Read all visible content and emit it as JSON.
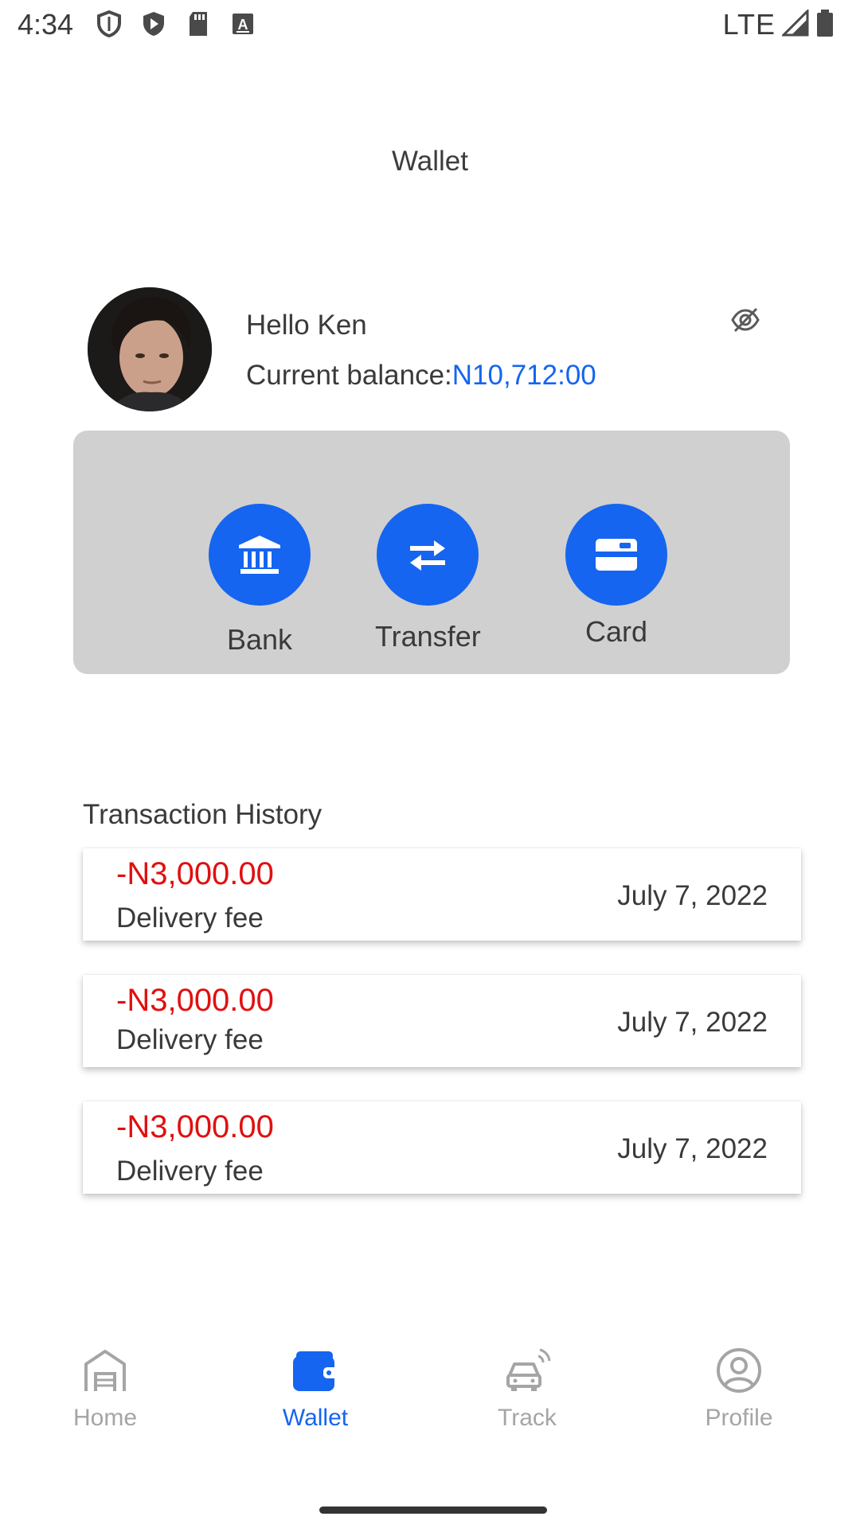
{
  "status_bar": {
    "time": "4:34",
    "network": "LTE",
    "icons": [
      "shield-icon",
      "play-protect-icon",
      "sd-card-icon",
      "keyboard-icon",
      "signal-icon",
      "battery-icon"
    ]
  },
  "header": {
    "title": "Wallet"
  },
  "profile": {
    "greeting": "Hello Ken",
    "balance_label": "Current balance:",
    "balance_value": "N10,712:00",
    "visibility_icon": "eye-off-icon"
  },
  "actions": [
    {
      "label": "Bank",
      "icon": "bank-icon"
    },
    {
      "label": "Transfer",
      "icon": "transfer-icon"
    },
    {
      "label": "Card",
      "icon": "card-icon"
    }
  ],
  "transactions": {
    "title": "Transaction History",
    "items": [
      {
        "amount": "-N3,000.00",
        "description": "Delivery fee",
        "date": "July 7, 2022"
      },
      {
        "amount": "-N3,000.00",
        "description": "Delivery fee",
        "date": "July 7, 2022"
      },
      {
        "amount": "-N3,000.00",
        "description": "Delivery fee",
        "date": "July 7, 2022"
      }
    ]
  },
  "bottom_nav": {
    "items": [
      {
        "label": "Home",
        "icon": "home-icon",
        "active": false
      },
      {
        "label": "Wallet",
        "icon": "wallet-icon",
        "active": true
      },
      {
        "label": "Track",
        "icon": "track-icon",
        "active": false
      },
      {
        "label": "Profile",
        "icon": "profile-icon",
        "active": false
      }
    ]
  },
  "colors": {
    "accent": "#1565f0",
    "negative": "#e01010",
    "panel": "#d0d0d0",
    "inactive_nav": "#a5a5a5"
  }
}
